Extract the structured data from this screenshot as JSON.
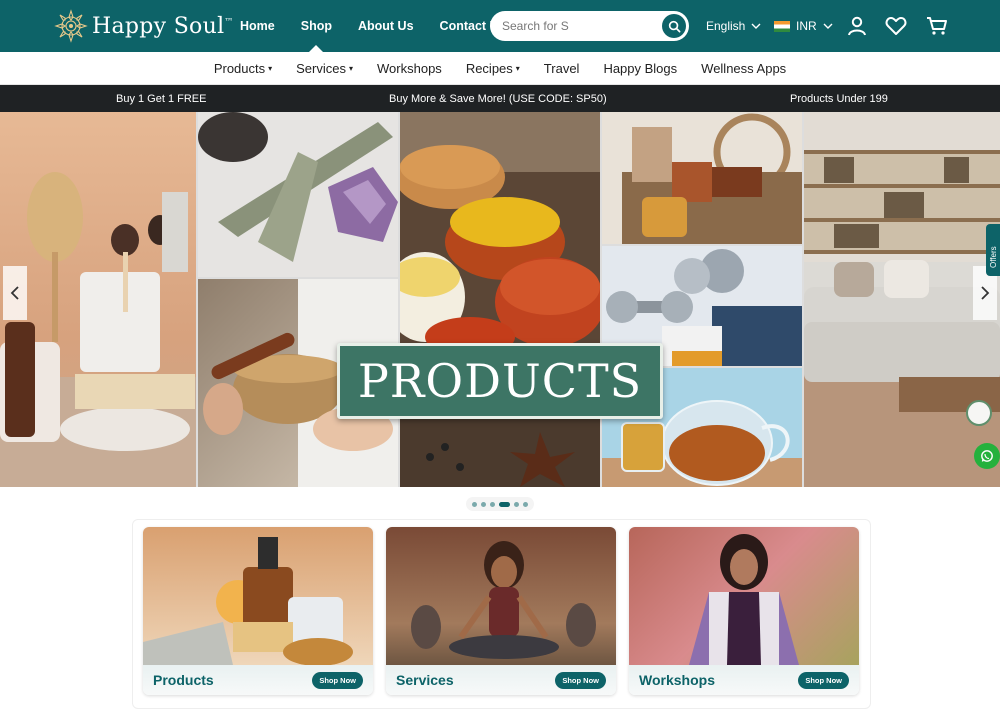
{
  "header": {
    "brand": "Happy Soul",
    "brand_tm": "™",
    "nav": [
      {
        "label": "Home"
      },
      {
        "label": "Shop"
      },
      {
        "label": "About Us"
      },
      {
        "label": "Contact Us"
      }
    ],
    "search": {
      "placeholder": "Search for S"
    },
    "language": "English",
    "currency": "INR",
    "icons": [
      "user-icon",
      "heart-icon",
      "cart-icon"
    ]
  },
  "subnav": [
    {
      "label": "Products",
      "dropdown": true
    },
    {
      "label": "Services",
      "dropdown": true
    },
    {
      "label": "Workshops",
      "dropdown": false
    },
    {
      "label": "Recipes",
      "dropdown": true
    },
    {
      "label": "Travel",
      "dropdown": false
    },
    {
      "label": "Happy Blogs",
      "dropdown": false
    },
    {
      "label": "Wellness Apps",
      "dropdown": false
    }
  ],
  "caret": "▾",
  "promo": {
    "left": "Buy 1 Get 1 FREE",
    "center": "Buy More & Save More! (USE CODE: SP50)",
    "right": "Products Under 199"
  },
  "hero": {
    "headline": "PRODUCTS",
    "slide_count": 6,
    "active_slide": 4
  },
  "side_tab": {
    "label": "Offers"
  },
  "cards": [
    {
      "title": "Products",
      "button": "Shop Now"
    },
    {
      "title": "Services",
      "button": "Shop Now"
    },
    {
      "title": "Workshops",
      "button": "Shop Now"
    }
  ],
  "colors": {
    "brand": "#0d6368",
    "promo_bg": "#1f2224",
    "badge": "#3d7565",
    "whatsapp": "#25b13d"
  }
}
